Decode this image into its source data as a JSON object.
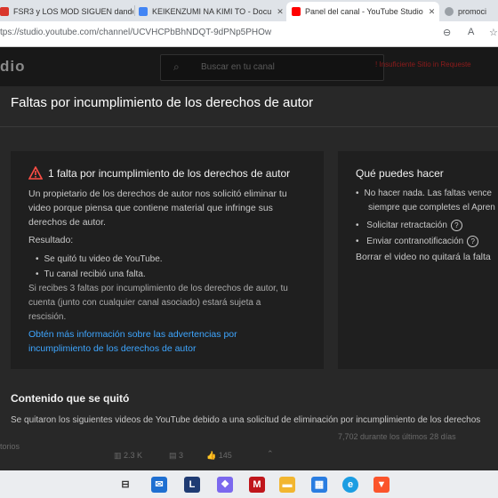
{
  "browser": {
    "tabs": [
      {
        "title": "FSR3 y LOS MOD SIGUEN dando",
        "color": "#d9362b"
      },
      {
        "title": "KEIKENZUMI NA KIMI TO - Docu",
        "color": "#4285f4"
      },
      {
        "title": "Panel del canal - YouTube Studio",
        "color": "#ff0000"
      },
      {
        "title": "promoci",
        "color": "#9aa0a6"
      }
    ],
    "url": "tps://studio.youtube.com/channel/UCVHCPbBhNDQT-9dPNp5PHOw"
  },
  "header": {
    "logo": "dio",
    "search_placeholder": "Buscar en tu canal",
    "warning": "! Insuficiente Sitio in Requeste"
  },
  "dialog": {
    "title": "Faltas por incumplimiento de los derechos de autor",
    "strike_card": {
      "title": "1 falta por incumplimiento de los derechos de autor",
      "paragraph1_line1": "Un propietario de los derechos de autor nos solicitó eliminar tu",
      "paragraph1_line2": "video porque piensa que contiene material que infringe sus",
      "paragraph1_line3": "derechos de autor.",
      "result_label": "Resultado:",
      "results": [
        "Se quitó tu video de YouTube.",
        "Tu canal recibió una falta."
      ],
      "warning_line1": "Si recibes 3 faltas por incumplimiento de los derechos de autor, tu",
      "warning_line2": "cuenta (junto con cualquier canal asociado) estará sujeta a",
      "warning_line3": "rescisión.",
      "link_line1": "Obtén más información sobre las advertencias por",
      "link_line2": "incumplimiento de los derechos de autor"
    },
    "actions_card": {
      "title": "Qué puedes hacer",
      "items": [
        "No hacer nada. Las faltas vence",
        "siempre que completes el Apren",
        "Solicitar retractación",
        "Enviar contranotificación"
      ],
      "footer": "Borrar el video no quitará la falta"
    },
    "removed": {
      "title": "Contenido que se quitó",
      "text": "Se quitaron los siguientes videos de YouTube debido a una solicitud de eliminación por incumplimiento de los derechos"
    }
  },
  "background": {
    "left_label": "torios",
    "stat_views": "2.3 K",
    "stat_comments": "3",
    "stat_likes": "145",
    "right_text": "7,702 durante los últimos 28 días"
  }
}
